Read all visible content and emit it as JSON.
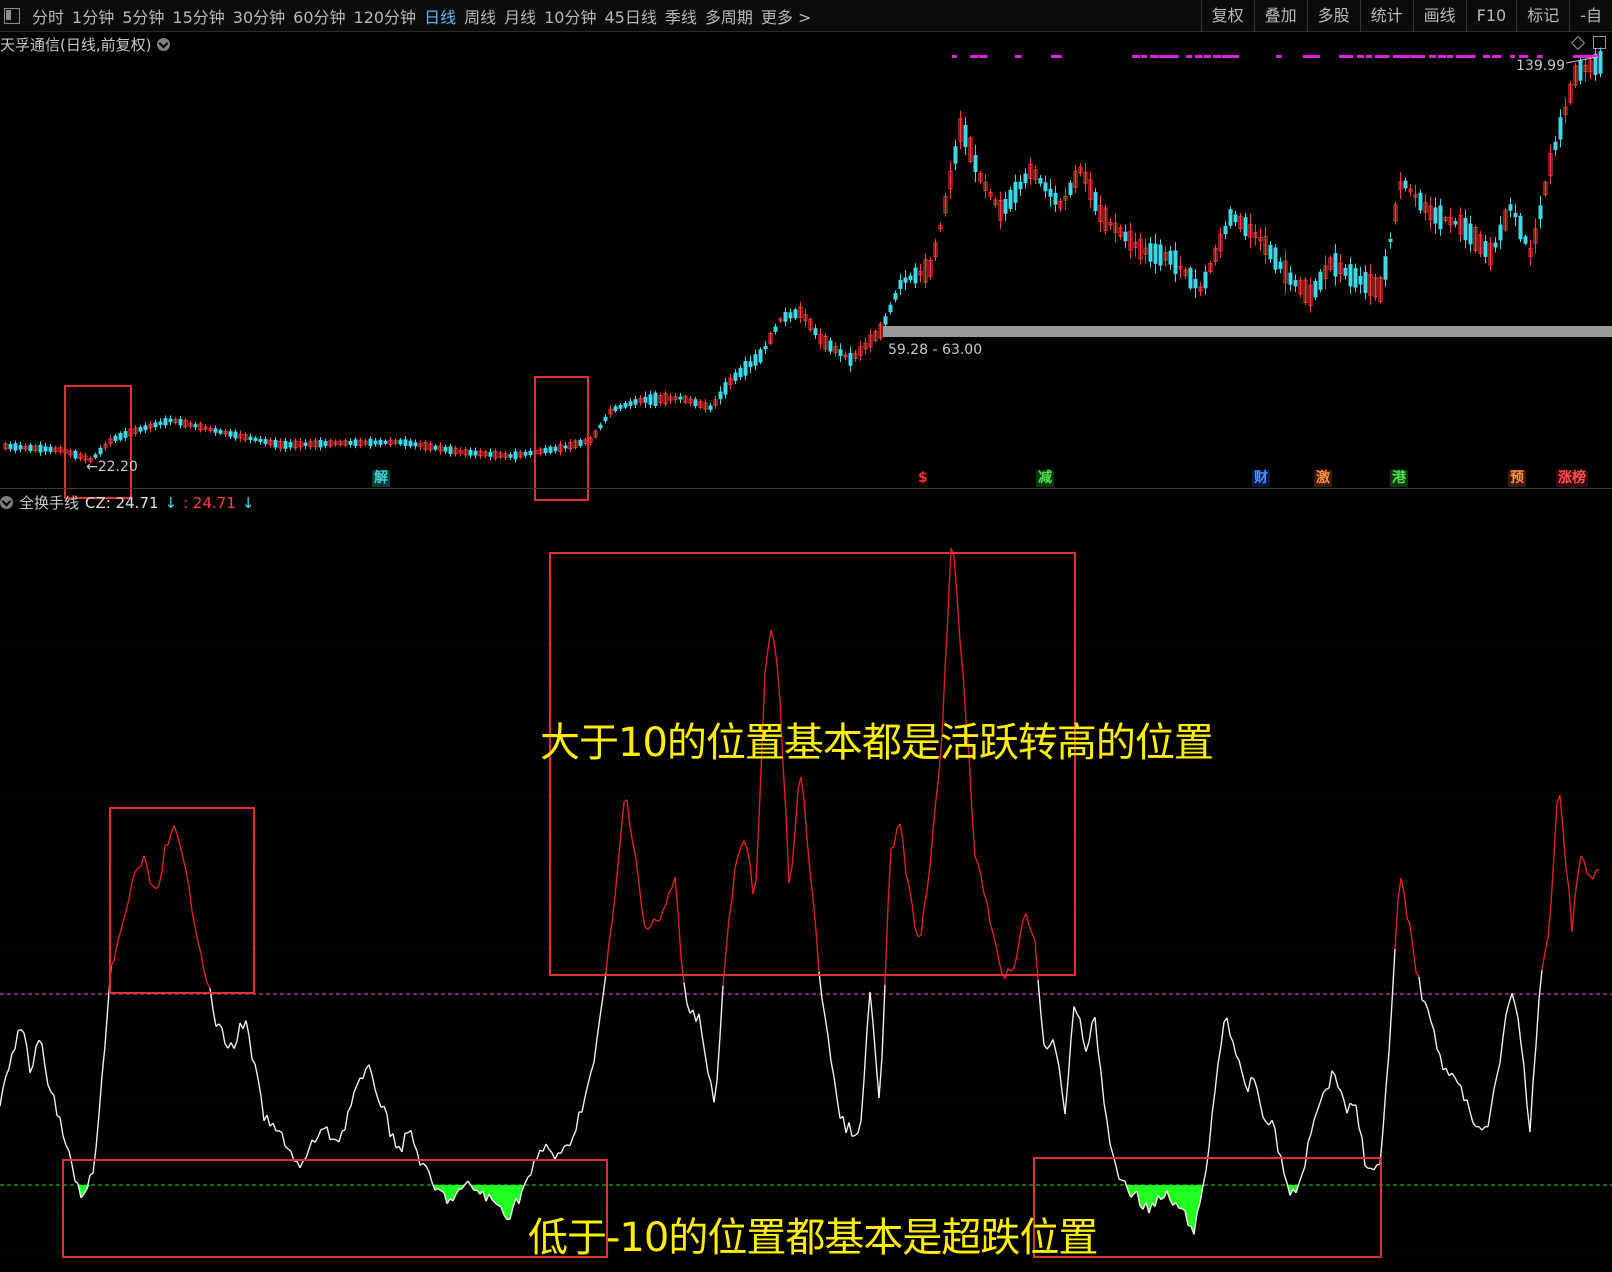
{
  "toolbar": {
    "periods": [
      {
        "label": "分时",
        "active": false
      },
      {
        "label": "1分钟",
        "active": false
      },
      {
        "label": "5分钟",
        "active": false
      },
      {
        "label": "15分钟",
        "active": false
      },
      {
        "label": "30分钟",
        "active": false
      },
      {
        "label": "60分钟",
        "active": false
      },
      {
        "label": "120分钟",
        "active": false
      },
      {
        "label": "日线",
        "active": true
      },
      {
        "label": "周线",
        "active": false
      },
      {
        "label": "月线",
        "active": false
      },
      {
        "label": "10分钟",
        "active": false
      },
      {
        "label": "45日线",
        "active": false
      },
      {
        "label": "季线",
        "active": false
      },
      {
        "label": "多周期",
        "active": false
      },
      {
        "label": "更多 >",
        "active": false
      }
    ],
    "tools": [
      "复权",
      "叠加",
      "多股",
      "统计",
      "画线",
      "F10",
      "标记",
      "-自"
    ]
  },
  "main_chart": {
    "title": "天孚通信(日线,前复权)",
    "high_label": "139.99",
    "low_label": "←22.20",
    "range_label": "59.28 - 63.00",
    "events": [
      {
        "label": "解",
        "color": "#40d0d0",
        "bg": "#0a3a3a"
      },
      {
        "label": "$",
        "color": "#ff3030",
        "bg": "transparent"
      },
      {
        "label": "减",
        "color": "#50e050",
        "bg": "#0a3a0a"
      },
      {
        "label": "财",
        "color": "#5090ff",
        "bg": "#0a1a3a"
      },
      {
        "label": "激",
        "color": "#ff9040",
        "bg": "#3a1a0a"
      },
      {
        "label": "港",
        "color": "#50e050",
        "bg": "#0a3a0a"
      },
      {
        "label": "预",
        "color": "#ff9040",
        "bg": "#3a1a0a"
      },
      {
        "label": "涨榜",
        "color": "#ff5050",
        "bg": "#3a0a0a"
      }
    ]
  },
  "indicator": {
    "name": "全换手线",
    "cz_label": "CZ: 24.71",
    "cz_arrow": "↓",
    "red_label": ": 24.71",
    "red_arrow": "↓"
  },
  "annotations": {
    "upper": "大于10的位置基本都是活跃转高的位置",
    "lower": "低于-10的位置都基本是超跌位置"
  },
  "colors": {
    "up": "#ff3b3b",
    "down": "#40d8e8",
    "line_white": "#f0f0f0",
    "line_red": "#e02020",
    "fill_green": "#20ff20",
    "box": "#e03030",
    "ref_upper": "#c040c0",
    "ref_lower": "#20b020",
    "annotation": "#ffee00"
  }
}
